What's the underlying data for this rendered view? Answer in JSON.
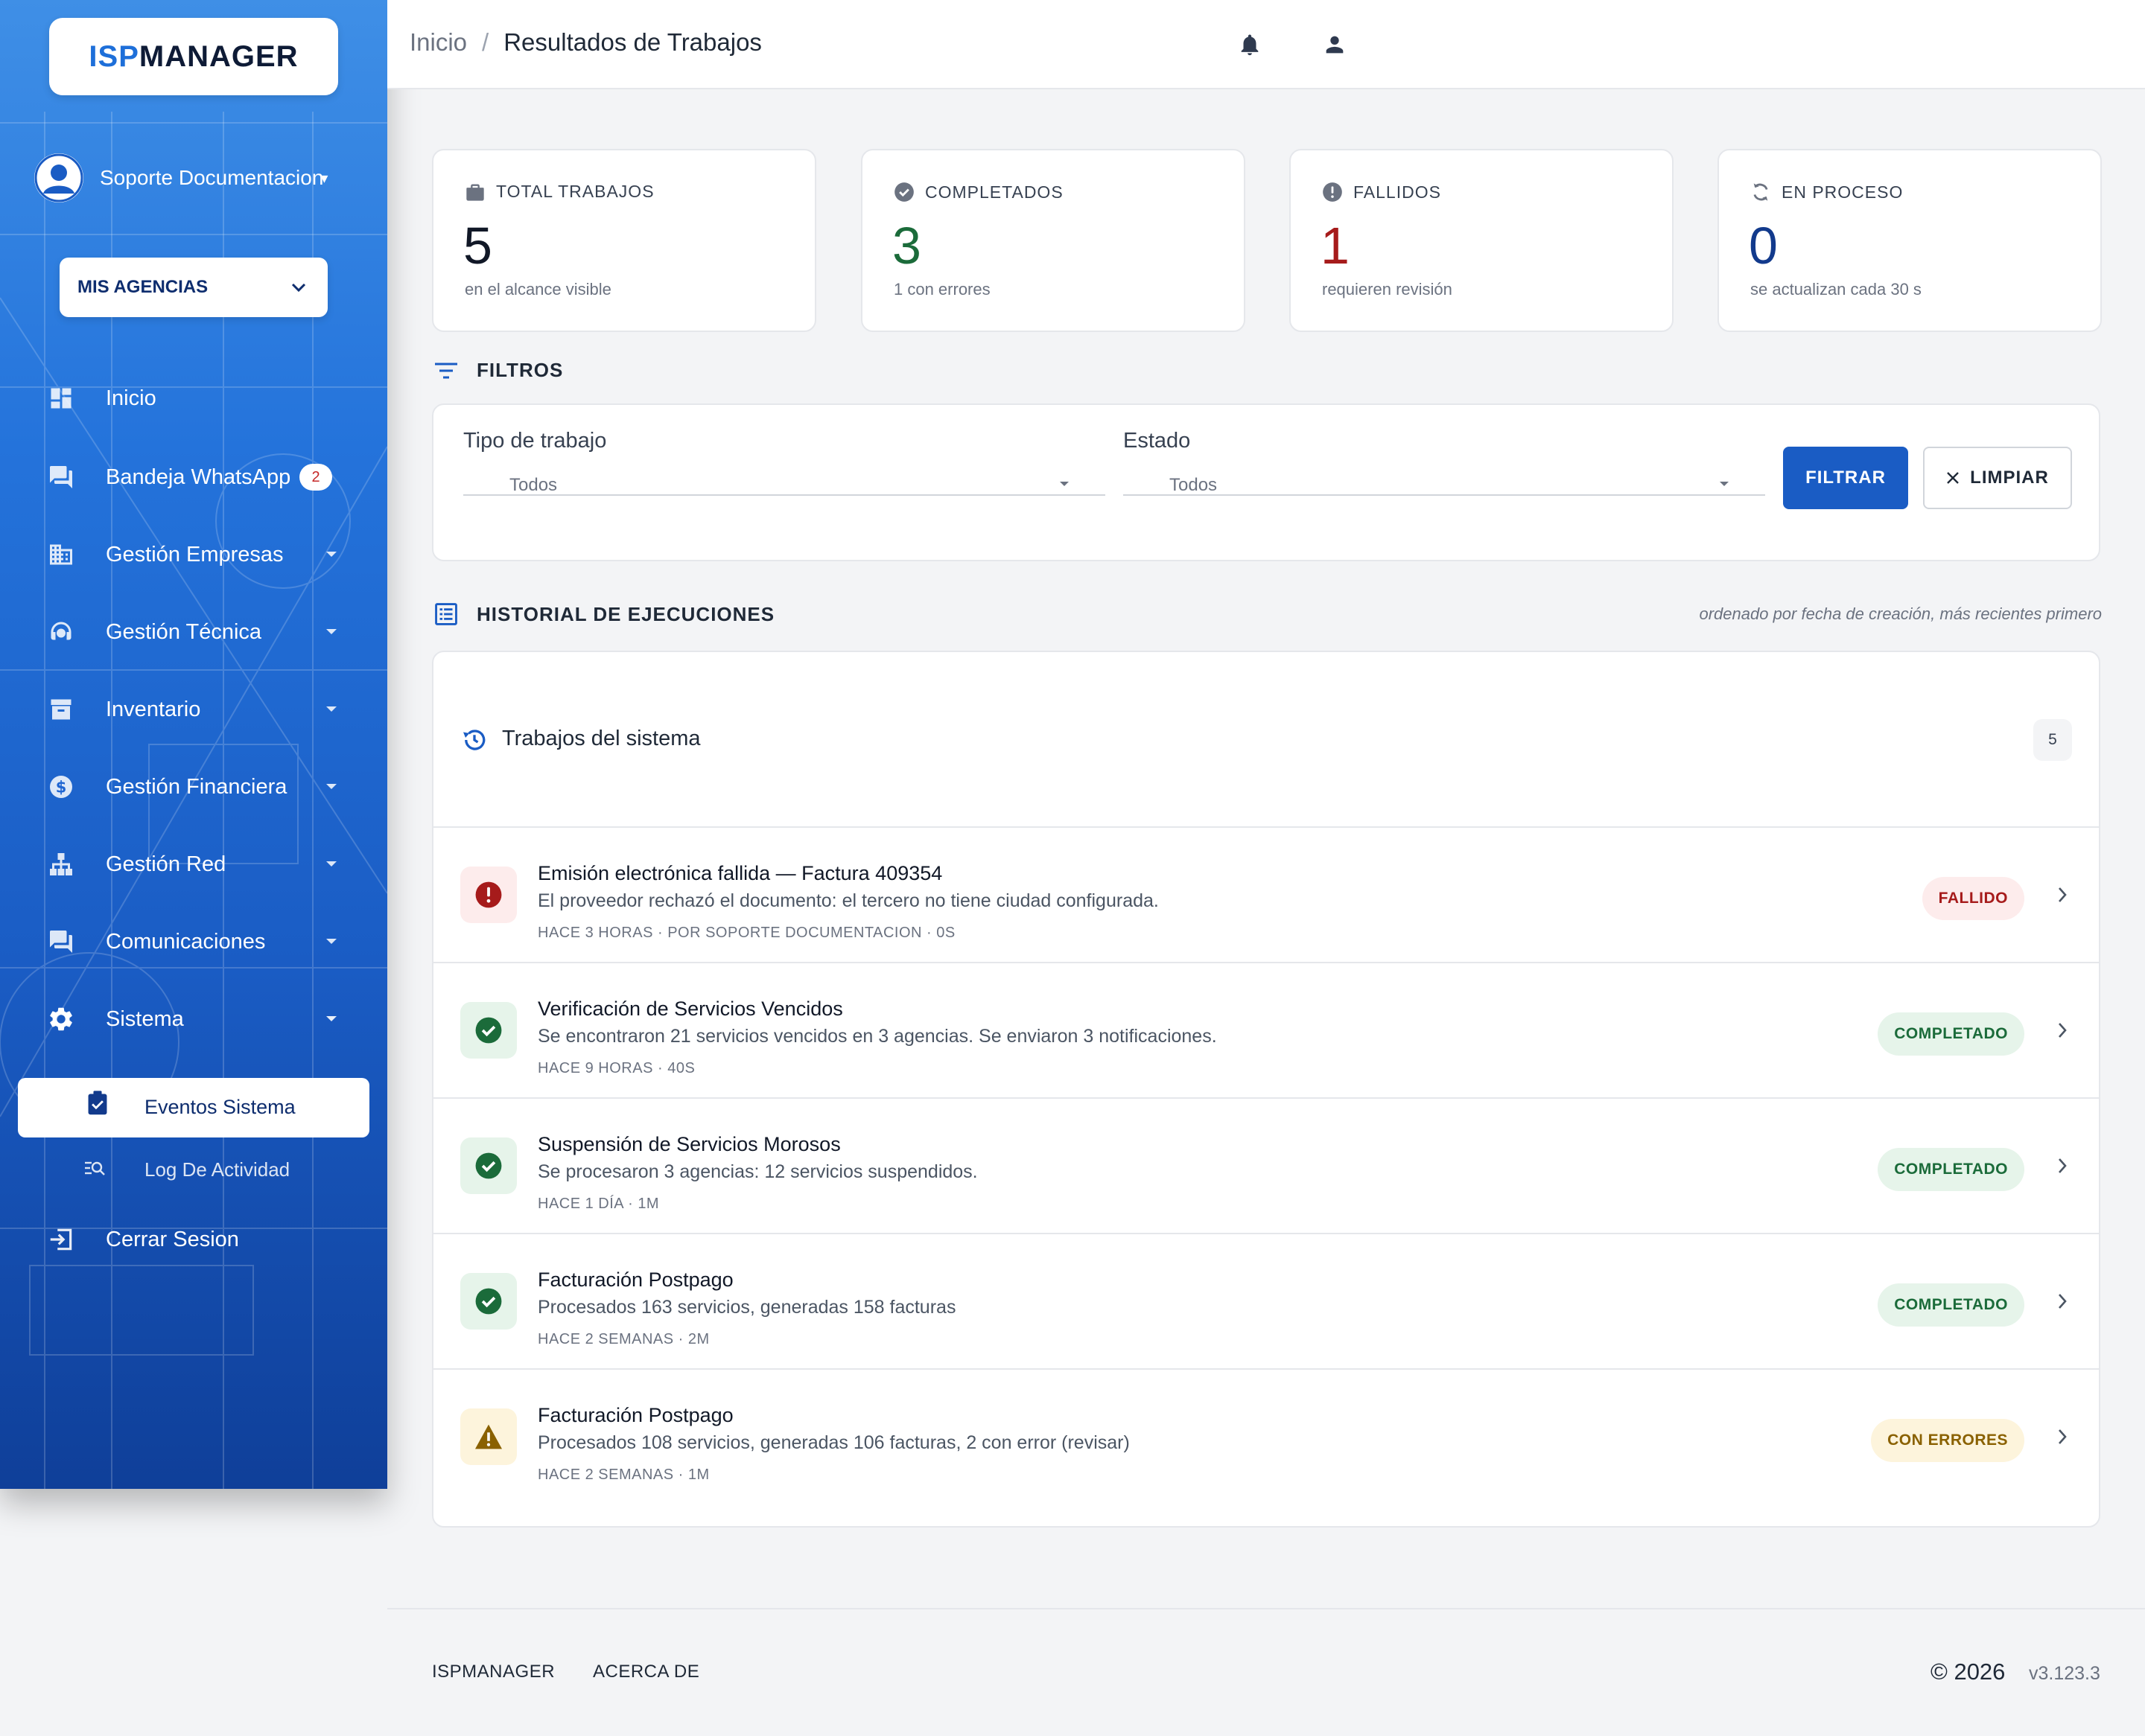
{
  "sidebar": {
    "logo": {
      "isp": "ISP",
      "manager": "MANAGER"
    },
    "user_name": "Soporte Documentacion",
    "agency_label": "MIS AGENCIAS",
    "nav": [
      {
        "label": "Inicio",
        "icon": "dashboard-icon"
      },
      {
        "label": "Bandeja WhatsApp",
        "icon": "chat-icon",
        "badge": "2"
      },
      {
        "label": "Gestión Empresas",
        "icon": "building-icon"
      },
      {
        "label": "Gestión Técnica",
        "icon": "support-agent-icon"
      },
      {
        "label": "Inventario",
        "icon": "archive-icon"
      },
      {
        "label": "Gestión Financiera",
        "icon": "dollar-icon"
      },
      {
        "label": "Gestión Red",
        "icon": "network-icon"
      },
      {
        "label": "Comunicaciones",
        "icon": "forum-icon"
      },
      {
        "label": "Sistema",
        "icon": "gear-icon"
      }
    ],
    "sub_active": "Eventos Sistema",
    "sub_item": "Log De Actividad",
    "logout": "Cerrar Sesion"
  },
  "topbar": {
    "crumb_home": "Inicio",
    "crumb_sep": "/",
    "crumb_current": "Resultados de Trabajos"
  },
  "stats": [
    {
      "title": "TOTAL TRABAJOS",
      "value": "5",
      "sub": "en el alcance visible",
      "color": "#111827"
    },
    {
      "title": "COMPLETADOS",
      "value": "3",
      "sub": "1 con errores",
      "color": "#1b6b3a"
    },
    {
      "title": "FALLIDOS",
      "value": "1",
      "sub": "requieren revisión",
      "color": "#a61b1b"
    },
    {
      "title": "EN PROCESO",
      "value": "0",
      "sub": "se actualizan cada 30 s",
      "color": "#123a8c"
    }
  ],
  "filters": {
    "title": "FILTROS",
    "type_label": "Tipo de trabajo",
    "type_value": "Todos",
    "state_label": "Estado",
    "state_value": "Todos",
    "filter_btn": "FILTRAR",
    "clear_btn": "LIMPIAR"
  },
  "history": {
    "title": "HISTORIAL DE EJECUCIONES",
    "note": "ordenado por fecha de creación, más recientes primero",
    "card_title": "Trabajos del sistema",
    "count": "5",
    "jobs": [
      {
        "title": "Emisión electrónica fallida — Factura 409354",
        "desc": "El proveedor rechazó el documento: el tercero no tiene ciudad configurada.",
        "meta": "HACE 3 HORAS · POR SOPORTE DOCUMENTACION · 0S",
        "status": "FALLIDO",
        "kind": "error"
      },
      {
        "title": "Verificación de Servicios Vencidos",
        "desc": "Se encontraron 21 servicios vencidos en 3 agencias. Se enviaron 3 notificaciones.",
        "meta": "HACE 9 HORAS · 40S",
        "status": "COMPLETADO",
        "kind": "ok"
      },
      {
        "title": "Suspensión de Servicios Morosos",
        "desc": "Se procesaron 3 agencias: 12 servicios suspendidos.",
        "meta": "HACE 1 DÍA · 1M",
        "status": "COMPLETADO",
        "kind": "ok"
      },
      {
        "title": "Facturación Postpago",
        "desc": "Procesados 163 servicios, generadas 158 facturas",
        "meta": "HACE 2 SEMANAS · 2M",
        "status": "COMPLETADO",
        "kind": "ok"
      },
      {
        "title": "Facturación Postpago",
        "desc": "Procesados 108 servicios, generadas 106 facturas, 2 con error (revisar)",
        "meta": "HACE 2 SEMANAS · 1M",
        "status": "CON ERRORES",
        "kind": "warn"
      }
    ]
  },
  "footer": {
    "link1": "ISPMANAGER",
    "link2": "ACERCA DE",
    "copyright": "© 2026",
    "version": "v3.123.3"
  },
  "colors": {
    "primary": "#1a5cc4",
    "error": "#a61b1b",
    "success": "#1b6b3a",
    "warning": "#8a6100"
  }
}
